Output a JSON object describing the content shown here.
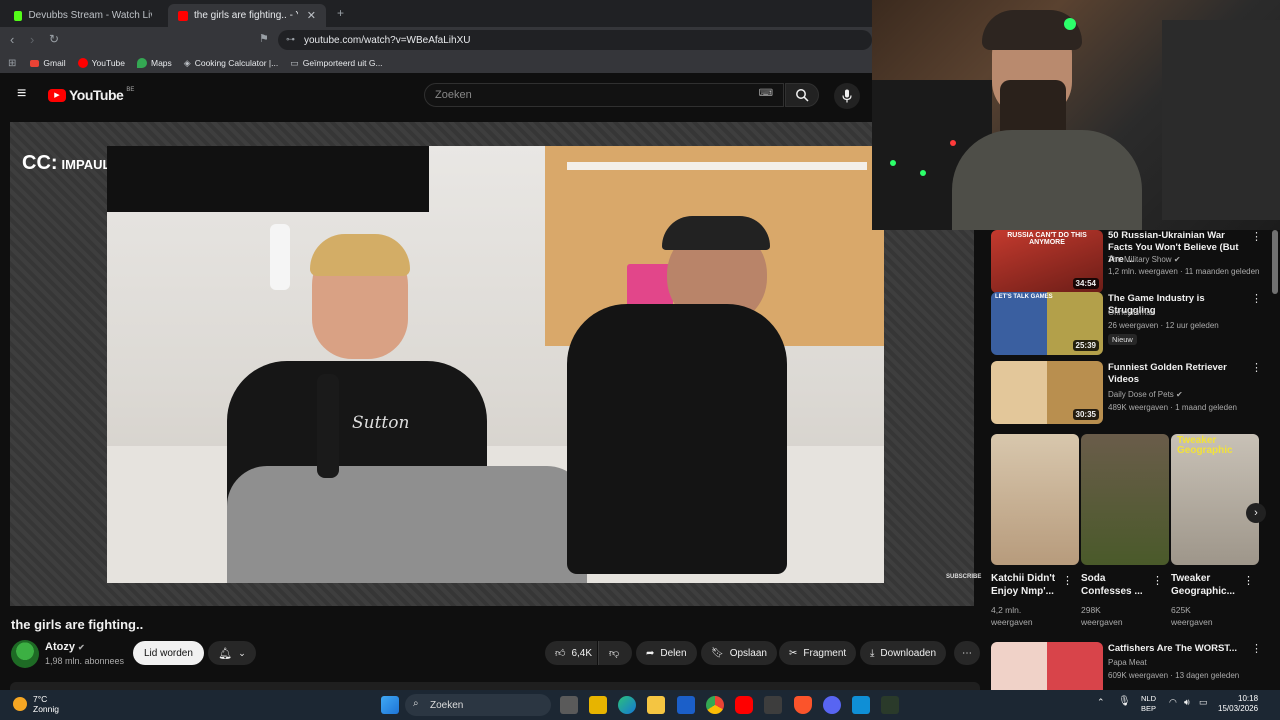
{
  "browser": {
    "tabs": [
      {
        "title": "Devubbs Stream - Watch Live on",
        "active": false,
        "favicon_color": "#53fc18"
      },
      {
        "title": "the girls are fighting.. - YouTu",
        "active": true,
        "favicon_color": "#ff0000"
      }
    ],
    "url": "youtube.com/watch?v=WBeAfaLihXU",
    "bookmarks": [
      "Gmail",
      "YouTube",
      "Maps",
      "Cooking Calculator |...",
      "Geïmporteerd uit G..."
    ]
  },
  "youtube": {
    "logo_text": "YouTube",
    "region": "BE",
    "search_placeholder": "Zoeken"
  },
  "video": {
    "caption_badge": "CC:",
    "caption_source": "IMPAULSIVE",
    "subscribe_watermark": "SUBSCRIBE",
    "title": "the girls are fighting..",
    "channel": "Atozy",
    "subscribers": "1,98 mln. abonnees",
    "join_label": "Lid worden",
    "likes": "6,4K",
    "share_label": "Delen",
    "save_label": "Opslaan",
    "clip_label": "Fragment",
    "download_label": "Downloaden"
  },
  "recommendations": [
    {
      "title": "50 Russian-Ukrainian War Facts You Won't Believe (But Are ...",
      "channel": "The Military Show",
      "verified": true,
      "meta": "1,2 mln. weergaven · 11 maanden geleden",
      "duration": "34:54",
      "thumb_color": "#b8302a",
      "thumb_text": "RUSSIA CAN'T DO THIS ANYMORE"
    },
    {
      "title": "The Game Industry is Struggling",
      "channel": "Ohheyitsmax",
      "verified": false,
      "meta": "26 weergaven · 12 uur geleden",
      "duration": "25:39",
      "badge": "Nieuw",
      "thumb_color": "#3a5fa0",
      "thumb_text": "LET'S TALK GAMES"
    },
    {
      "title": "Funniest Golden Retriever Videos",
      "channel": "Daily Dose of Pets",
      "verified": true,
      "meta": "489K weergaven · 1 maand geleden",
      "duration": "30:35",
      "thumb_color": "#c9a36a",
      "thumb_text": ""
    },
    {
      "title": "Catfishers Are The WORST...",
      "channel": "Papa Meat",
      "verified": false,
      "meta": "609K weergaven · 13 dagen geleden",
      "duration": "",
      "thumb_color": "#d8444a",
      "thumb_text": ""
    }
  ],
  "shorts": [
    {
      "title": "Katchii Didn't Enjoy Nmp'...",
      "views": "4,2 mln. weergaven",
      "thumb_color": "#c8b49a"
    },
    {
      "title": "Soda Confesses ...",
      "views": "298K weergaven",
      "thumb_color": "#5a6a3a"
    },
    {
      "title": "Tweaker Geographic...",
      "views": "625K weergaven",
      "thumb_color": "#b9b1a6",
      "overlay": "Tweaker Geographic"
    }
  ],
  "taskbar": {
    "weather_temp": "7°C",
    "weather_desc": "Zonnig",
    "search_placeholder": "Zoeken",
    "lang_top": "NLD",
    "lang_bottom": "BEP",
    "time": "10:18",
    "date": "15/03/2026"
  }
}
